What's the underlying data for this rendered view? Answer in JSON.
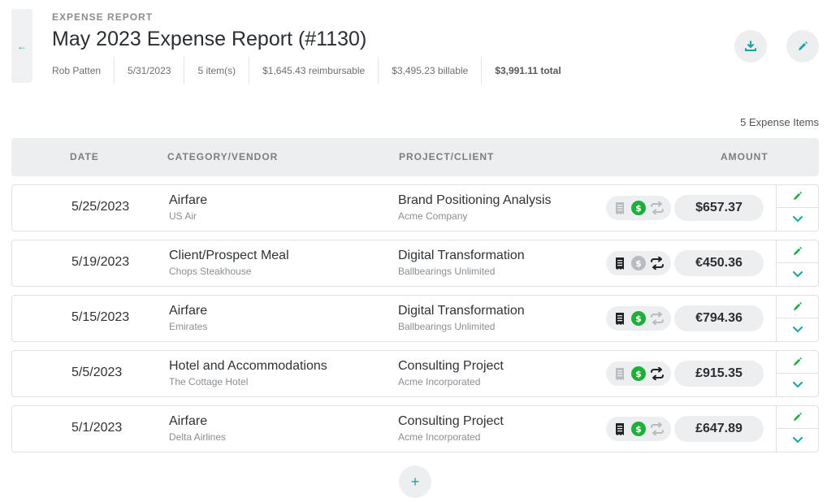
{
  "header": {
    "eyebrow": "EXPENSE REPORT",
    "title": "May 2023 Expense Report (#1130)",
    "meta": [
      "Rob Patten",
      "5/31/2023",
      "5 item(s)",
      "$1,645.43 reimbursable",
      "$3,495.23 billable",
      "$3,991.11 total"
    ]
  },
  "list": {
    "count_label": "5 Expense Items",
    "columns": {
      "date": "DATE",
      "category": "CATEGORY/VENDOR",
      "project": "PROJECT/CLIENT",
      "amount": "AMOUNT"
    },
    "rows": [
      {
        "date": "5/25/2023",
        "category": "Airfare",
        "vendor": "US Air",
        "project": "Brand Positioning Analysis",
        "client": "Acme Company",
        "amount": "$657.37",
        "receipt": false,
        "reimbursable": true,
        "billable": false
      },
      {
        "date": "5/19/2023",
        "category": "Client/Prospect Meal",
        "vendor": "Chops Steakhouse",
        "project": "Digital Transformation",
        "client": "Ballbearings Unlimited",
        "amount": "€450.36",
        "receipt": true,
        "reimbursable": false,
        "billable": true
      },
      {
        "date": "5/15/2023",
        "category": "Airfare",
        "vendor": "Emirates",
        "project": "Digital Transformation",
        "client": "Ballbearings Unlimited",
        "amount": "€794.36",
        "receipt": true,
        "reimbursable": true,
        "billable": false
      },
      {
        "date": "5/5/2023",
        "category": "Hotel and Accommodations",
        "vendor": "The Cottage Hotel",
        "project": "Consulting Project",
        "client": "Acme Incorporated",
        "amount": "£915.35",
        "receipt": false,
        "reimbursable": true,
        "billable": true
      },
      {
        "date": "5/1/2023",
        "category": "Airfare",
        "vendor": "Delta Airlines",
        "project": "Consulting Project",
        "client": "Acme Incorporated",
        "amount": "£647.89",
        "receipt": true,
        "reimbursable": true,
        "billable": false
      }
    ]
  },
  "icons": {
    "back": "arrow-left-icon",
    "download": "download-icon",
    "edit": "pencil-icon",
    "expand": "chevron-down-icon",
    "add": "plus-icon",
    "receipt": "receipt-icon",
    "reimbursable": "dollar-icon",
    "billable": "repeat-icon"
  },
  "colors": {
    "accent": "#1aa3a3",
    "green": "#1fae3c",
    "dark": "#222222",
    "muted": "#b8bcc0"
  }
}
